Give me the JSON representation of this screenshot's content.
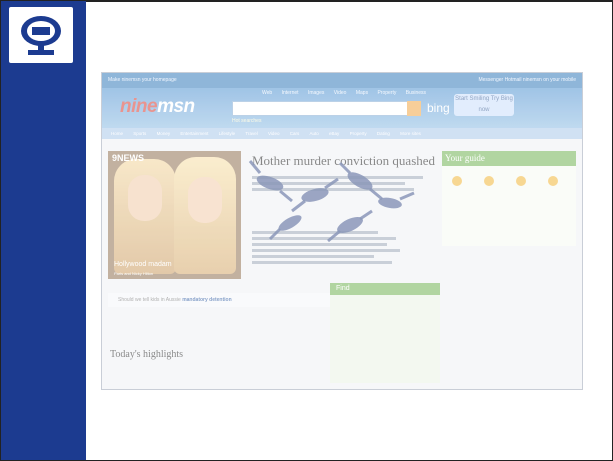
{
  "slide": {
    "colors": {
      "band": "#1c3b90",
      "background": "#ffffff"
    },
    "logo_icon": "circle-emblem-icon"
  },
  "screenshot": {
    "topbar": {
      "left": "Make ninemsn your homepage",
      "right": "Messenger  Hotmail  ninemsn on your mobile"
    },
    "brand": {
      "nine": "nine",
      "msn": "msn"
    },
    "search_tabs": [
      "Web",
      "Internet",
      "Images",
      "Video",
      "Maps",
      "Property",
      "Business"
    ],
    "bing": "bing",
    "popular_searches": "Hot searches",
    "promo": "Start Smiling Try Bing now",
    "nav_items": [
      "Home",
      "Sports",
      "Money",
      "Entertainment",
      "Lifestyle",
      "Travel",
      "Video",
      "Cars",
      "Auto",
      "eBay",
      "Property",
      "Dating",
      "More sites"
    ],
    "news_label": "9NEWS",
    "news_caption": "Hollywood madam",
    "news_sub": "Paris and Nicky Hilton",
    "headline": "Mother murder conviction quashed",
    "your_guide": "Your guide",
    "ask_text": "Should we tell kids in Aussie",
    "ask_bold": "mandatory detention",
    "find_title": "Find",
    "highlights": "Today's highlights"
  }
}
